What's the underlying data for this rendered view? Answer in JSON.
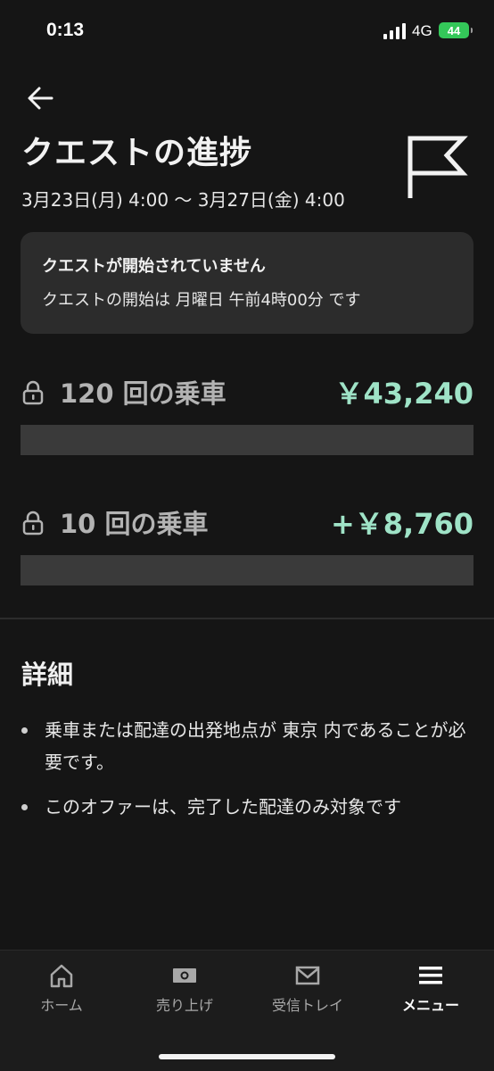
{
  "status_bar": {
    "time": "0:13",
    "network": "4G",
    "battery": "44"
  },
  "header": {
    "title": "クエストの進捗",
    "date_range": "3月23日(月) 4:00 〜 3月27日(金) 4:00"
  },
  "notice": {
    "title": "クエストが開始されていません",
    "body": "クエストの開始は 月曜日 午前4時00分 です"
  },
  "tiers": [
    {
      "label": "120 回の乗車",
      "amount": "￥43,240",
      "progress": 0
    },
    {
      "label": "10 回の乗車",
      "amount": "+￥8,760",
      "progress": 0
    }
  ],
  "details": {
    "title": "詳細",
    "items": [
      "乗車または配達の出発地点が 東京 内であることが必要です。",
      "このオファーは、完了した配達のみ対象です"
    ]
  },
  "bottom_nav": {
    "items": [
      {
        "label": "ホーム",
        "icon": "home-icon"
      },
      {
        "label": "売り上げ",
        "icon": "cash-icon"
      },
      {
        "label": "受信トレイ",
        "icon": "mail-icon"
      },
      {
        "label": "メニュー",
        "icon": "menu-icon",
        "active": true
      }
    ]
  },
  "colors": {
    "background": "#151515",
    "card": "#2c2c2c",
    "accent_green": "#9fe3c7",
    "progress_track": "#3a3a3a",
    "battery": "#34c759"
  }
}
